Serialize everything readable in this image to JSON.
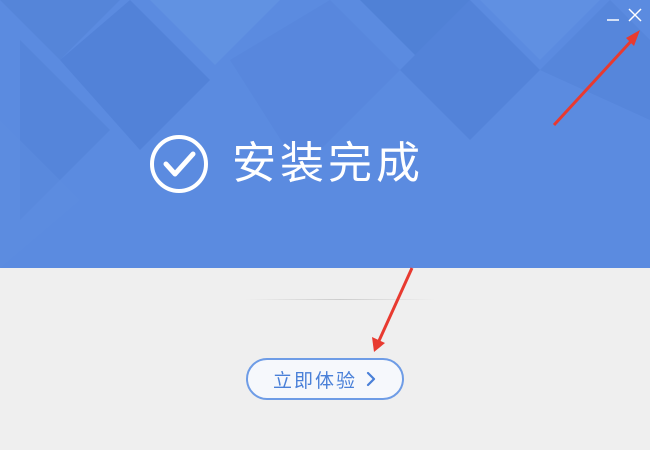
{
  "window": {
    "minimize_icon": "minimize-icon",
    "close_icon": "close-icon"
  },
  "header": {
    "status_icon": "check-circle-icon",
    "title": "安装完成"
  },
  "footer": {
    "start_button_label": "立即体验",
    "start_button_icon": "chevron-right-icon"
  },
  "colors": {
    "banner": "#5b8be0",
    "background": "#efefef",
    "button_border": "#6e9ce6",
    "button_text": "#4a80d8",
    "annotation_arrow": "#e83a30"
  }
}
